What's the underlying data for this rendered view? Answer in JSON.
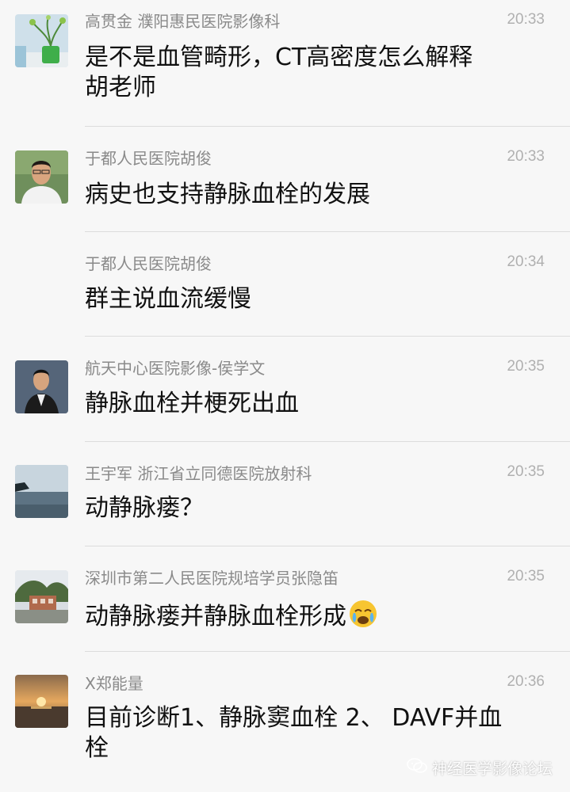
{
  "messages": [
    {
      "sender": "高贯金  濮阳惠民医院影像科",
      "time": "20:33",
      "text": "是不是血管畸形，CT高密度怎么解释\n胡老师",
      "avatar": "plant-avatar"
    },
    {
      "sender": "于都人民医院胡俊",
      "time": "20:33",
      "text": "病史也支持静脉血栓的发展",
      "avatar": "man-avatar"
    },
    {
      "sender": "于都人民医院胡俊",
      "time": "20:34",
      "text": "群主说血流缓慢",
      "avatar": ""
    },
    {
      "sender": "航天中心医院影像-侯学文",
      "time": "20:35",
      "text": "静脉血栓并梗死出血",
      "avatar": "suit-man-avatar"
    },
    {
      "sender": "王宇军 浙江省立同德医院放射科",
      "time": "20:35",
      "text": "动静脉瘘？",
      "avatar": "seascape-avatar"
    },
    {
      "sender": "深圳市第二人民医院规培学员张隐笛",
      "time": "20:35",
      "text": "动静脉瘘并静脉血栓形成",
      "avatar": "campus-avatar",
      "emoji": "crying-face-emoji"
    },
    {
      "sender": "X郑能量",
      "time": "20:36",
      "text": "目前诊断1、静脉窦血栓 2、 DAVF并血\n栓",
      "avatar": "sunset-avatar"
    }
  ],
  "watermark": "神经医学影像论坛"
}
